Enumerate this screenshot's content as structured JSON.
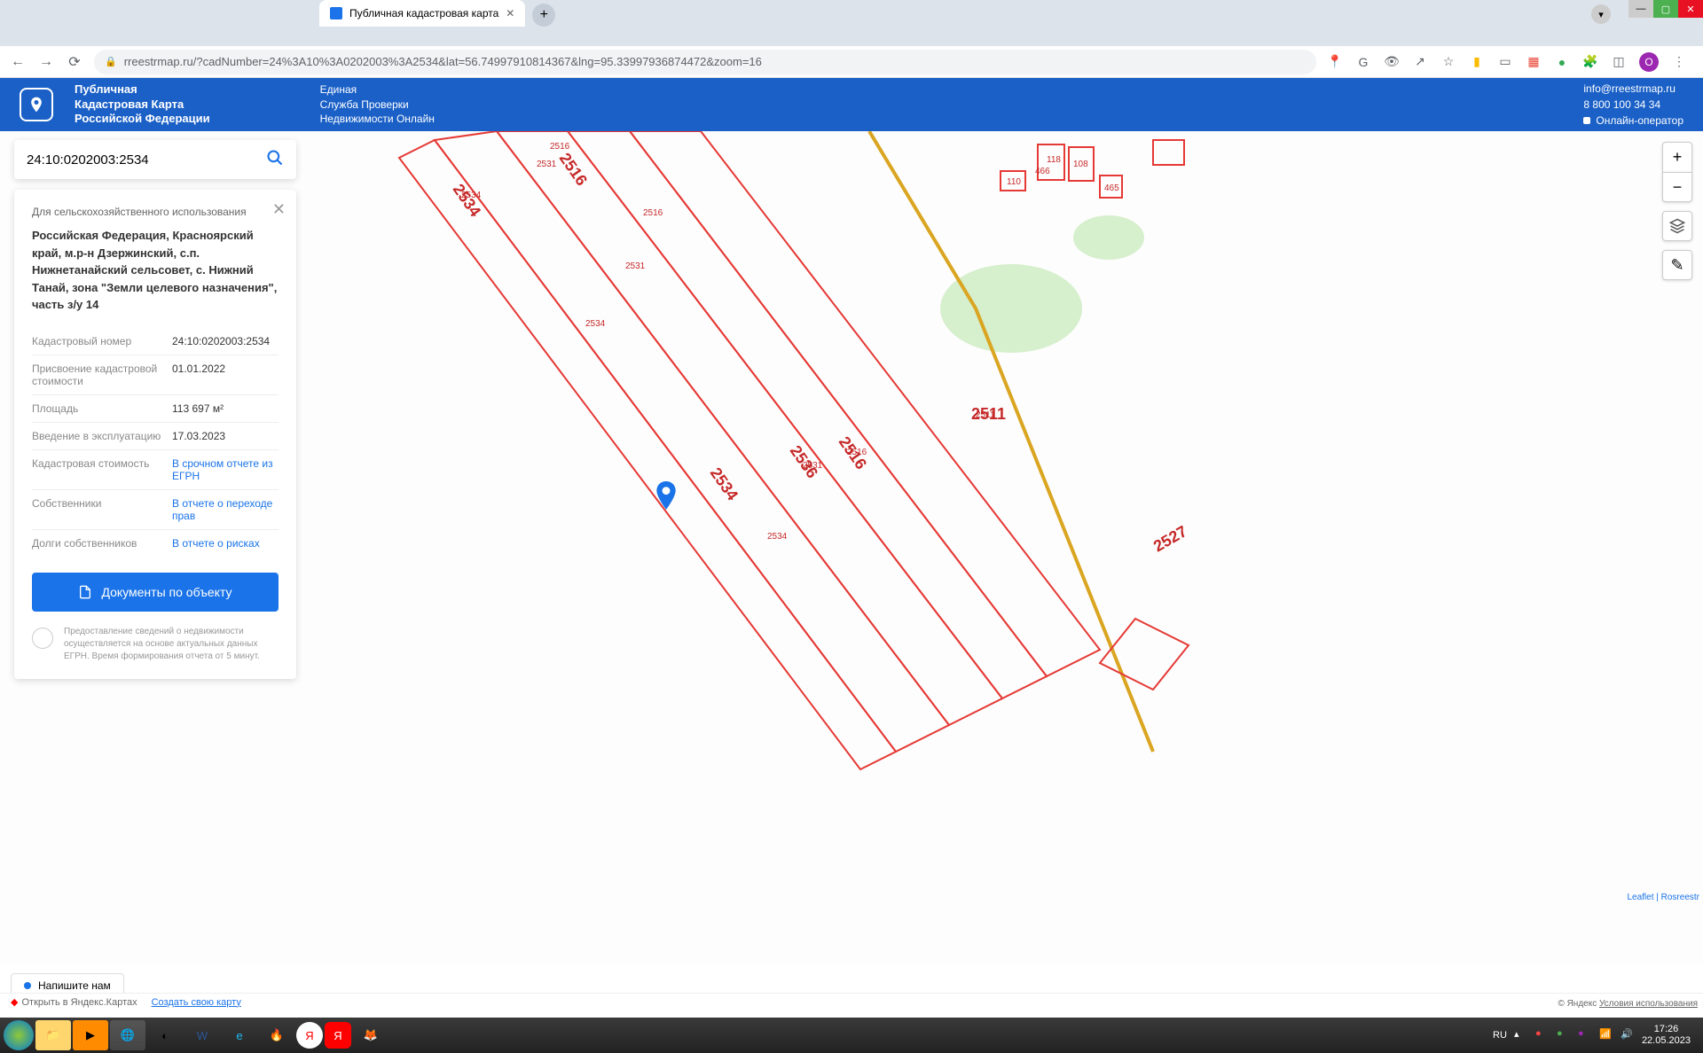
{
  "browser": {
    "tab_title": "Публичная кадастровая карта",
    "url": "rreestrmap.ru/?cadNumber=24%3A10%3A0202003%3A2534&lat=56.74997910814367&lng=95.33997936874472&zoom=16"
  },
  "header": {
    "title_line1": "Публичная",
    "title_line2": "Кадастровая Карта",
    "title_line3": "Российской Федерации",
    "subtitle_line1": "Единая",
    "subtitle_line2": "Служба Проверки",
    "subtitle_line3": "Недвижимости Онлайн",
    "email": "info@rreestrmap.ru",
    "phone": "8 800 100 34 34",
    "online_op": "Онлайн-оператор"
  },
  "search": {
    "value": "24:10:0202003:2534"
  },
  "info": {
    "category": "Для сельскохозяйственного использования",
    "address": "Российская Федерация, Красноярский край, м.р-н Дзержинский, с.п. Нижнетанайский сельсовет, с. Нижний Танай, зона \"Земли целевого назначения\", часть з/у 14",
    "rows": [
      {
        "label": "Кадастровый номер",
        "value": "24:10:0202003:2534",
        "link": false
      },
      {
        "label": "Присвоение кадастровой стоимости",
        "value": "01.01.2022",
        "link": false
      },
      {
        "label": "Площадь",
        "value": "113 697 м²",
        "link": false
      },
      {
        "label": "Введение в эксплуатацию",
        "value": "17.03.2023",
        "link": false
      },
      {
        "label": "Кадастровая стоимость",
        "value": "В срочном отчете из ЕГРН",
        "link": true
      },
      {
        "label": "Собственники",
        "value": "В отчете о переходе прав",
        "link": true
      },
      {
        "label": "Долги собственников",
        "value": "В отчете о рисках",
        "link": true
      }
    ],
    "docs_button": "Документы по объекту",
    "disclaimer": "Предоставление сведений о недвижимости осуществляется на основе актуальных данных ЕГРН. Время формирования отчета от 5 минут."
  },
  "map": {
    "parcel_labels": [
      "2516",
      "2531",
      "2534",
      "2511",
      "2536",
      "2527",
      "118",
      "108",
      "110",
      "465",
      "466"
    ],
    "attribution": "Leaflet | Rosreestr",
    "yandex_copy": "© Яндекс",
    "yandex_terms": "Условия использования"
  },
  "widgets": {
    "chat": "Напишите нам",
    "yandex_open": "Открыть в Яндекс.Картах",
    "yandex_create": "Создать свою карту"
  },
  "taskbar": {
    "lang": "RU",
    "time": "17:26",
    "date": "22.05.2023"
  }
}
